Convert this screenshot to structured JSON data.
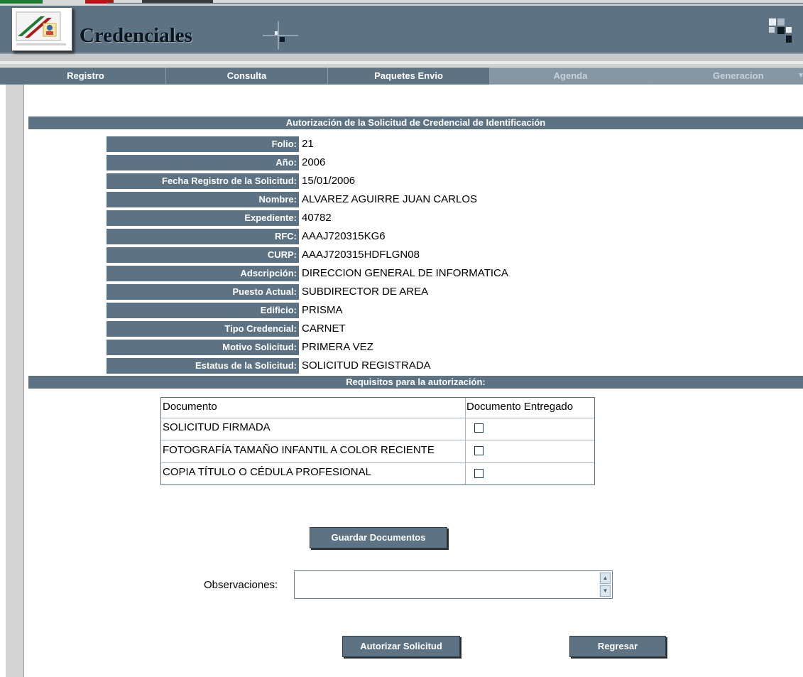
{
  "header": {
    "app_title": "Credenciales"
  },
  "nav": {
    "items": [
      {
        "label": "Registro"
      },
      {
        "label": "Consulta"
      },
      {
        "label": "Paquetes Envio"
      },
      {
        "label": "Agenda"
      },
      {
        "label": "Generacion"
      }
    ]
  },
  "main": {
    "section_title": "Autorización de la Solicitud de Credencial de Identificación",
    "fields": [
      {
        "label": "Folio:",
        "value": "21"
      },
      {
        "label": "Año:",
        "value": "2006"
      },
      {
        "label": "Fecha Registro de la Solicitud:",
        "value": "15/01/2006"
      },
      {
        "label": "Nombre:",
        "value": "ALVAREZ AGUIRRE JUAN CARLOS"
      },
      {
        "label": "Expediente:",
        "value": "40782"
      },
      {
        "label": "RFC:",
        "value": "AAAJ720315KG6"
      },
      {
        "label": "CURP:",
        "value": "AAAJ720315HDFLGN08"
      },
      {
        "label": "Adscripción:",
        "value": "DIRECCION GENERAL DE INFORMATICA"
      },
      {
        "label": "Puesto Actual:",
        "value": "SUBDIRECTOR DE AREA"
      },
      {
        "label": "Edificio:",
        "value": "PRISMA"
      },
      {
        "label": "Tipo Credencial:",
        "value": "CARNET"
      },
      {
        "label": "Motivo Solicitud:",
        "value": "PRIMERA VEZ"
      },
      {
        "label": "Estatus de la Solicitud:",
        "value": "SOLICITUD REGISTRADA"
      }
    ],
    "requirements_title": "Requisitos para la autorización:",
    "requirements": {
      "col_document": "Documento",
      "col_delivered": "Documento Entregado",
      "rows": [
        {
          "document": "SOLICITUD FIRMADA",
          "delivered": false
        },
        {
          "document": "FOTOGRAFÍA TAMAÑO INFANTIL A COLOR RECIENTE",
          "delivered": false
        },
        {
          "document": "COPIA TÍTULO O CÉDULA PROFESIONAL",
          "delivered": false
        }
      ]
    },
    "save_docs_label": "Guardar Documentos",
    "observations_label": "Observaciones:",
    "observations_value": "",
    "authorize_label": "Autorizar Solicitud",
    "back_label": "Regresar"
  },
  "colors": {
    "accent": "#5d7383",
    "nav_dim": "#8597a4",
    "page_bg": "#ffffff"
  }
}
